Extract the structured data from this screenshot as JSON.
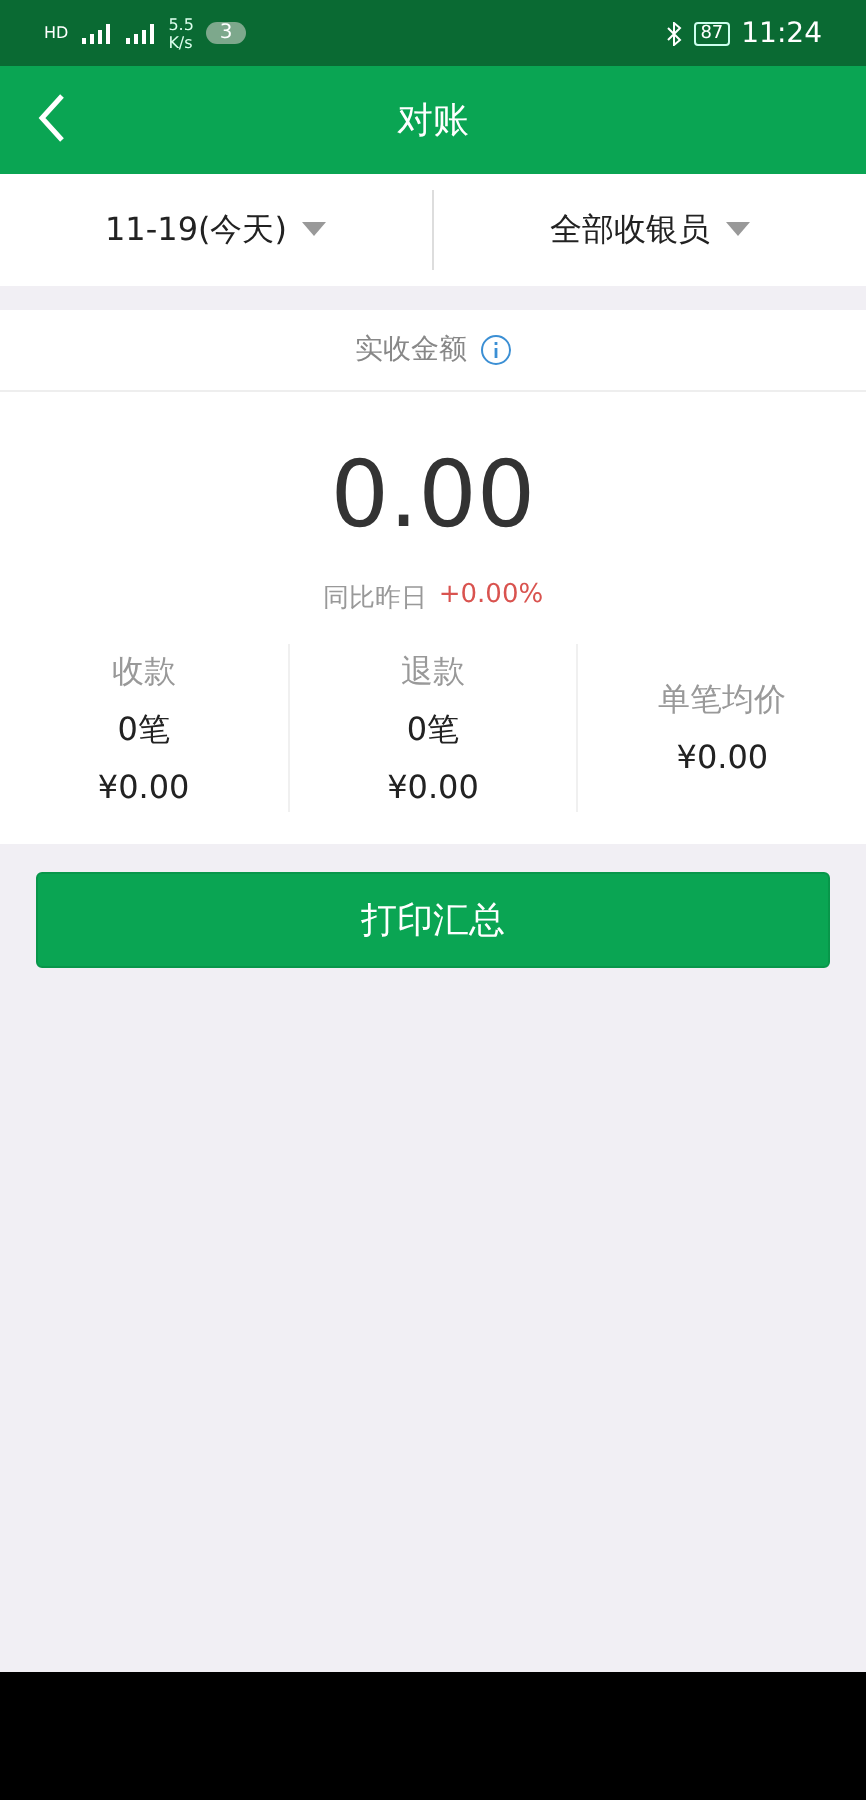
{
  "status_bar": {
    "hd": "HD",
    "net_speed": "5.5",
    "net_unit": "K/s",
    "notification_count": "3",
    "battery": "87",
    "time": "11:24"
  },
  "header": {
    "title": "对账"
  },
  "filters": [
    {
      "label": "11-19(今天)"
    },
    {
      "label": "全部收银员"
    }
  ],
  "summary": {
    "label": "实收金额",
    "amount": "0.00",
    "compare_label": "同比昨日",
    "compare_value": "+0.00%"
  },
  "stats": [
    {
      "title": "收款",
      "count": "0笔",
      "amount": "¥0.00"
    },
    {
      "title": "退款",
      "count": "0笔",
      "amount": "¥0.00"
    },
    {
      "title": "单笔均价",
      "amount": "¥0.00"
    }
  ],
  "print_button": "打印汇总"
}
